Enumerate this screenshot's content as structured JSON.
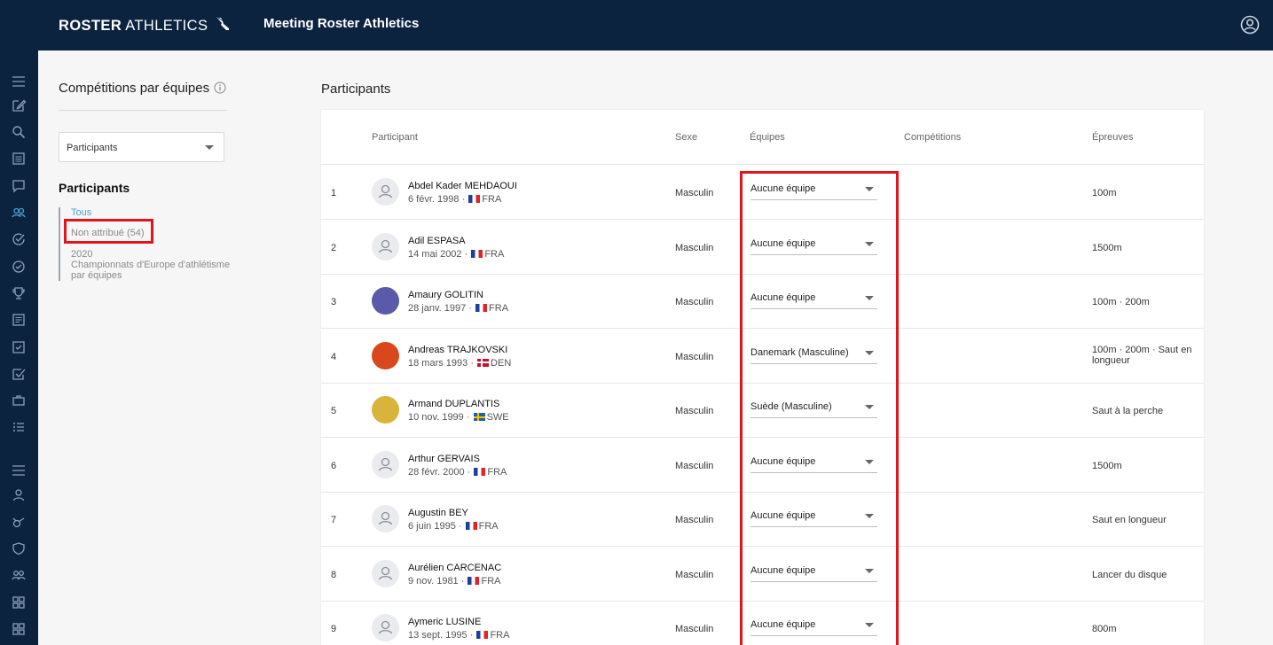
{
  "topbar": {
    "logo_bold": "ROSTER",
    "logo_light": "ATHLETICS",
    "app_title": "Meeting Roster Athletics",
    "account_icon": "account-circle-icon"
  },
  "rail_icons": [
    "menu-icon",
    "edit-icon",
    "search-icon",
    "list-icon",
    "chat-icon",
    "people-icon",
    "check-circle-icon",
    "check-circle-outline-icon",
    "trophy-icon",
    "news-icon",
    "checklist-icon",
    "double-check-icon",
    "briefcase-icon",
    "bullet-list-icon",
    "menu-icon",
    "person-icon",
    "whistle-icon",
    "shield-icon",
    "group-icon",
    "grid-icon",
    "grid-icon"
  ],
  "left": {
    "title": "Compétitions par équipes",
    "select_value": "Participants",
    "subtitle": "Participants",
    "filters": {
      "all": "Tous",
      "unassigned": "Non attribué (54)",
      "year": "2020",
      "event_line1": "Championnats d'Europe d'athlétisme",
      "event_line2": "par équipes"
    }
  },
  "main": {
    "title": "Participants",
    "columns": {
      "participant": "Participant",
      "sex": "Sexe",
      "teams": "Équipes",
      "competitions": "Compétitions",
      "events": "Épreuves"
    }
  },
  "rows": [
    {
      "num": "1",
      "name": "Abdel Kader MEHDAOUI",
      "date": "6 févr. 1998",
      "country": "FRA",
      "flag": "fra",
      "photo": false,
      "sex": "Masculin",
      "team": "Aucune équipe",
      "events": "100m"
    },
    {
      "num": "2",
      "name": "Adil ESPASA",
      "date": "14 mai 2002",
      "country": "FRA",
      "flag": "fra",
      "photo": false,
      "sex": "Masculin",
      "team": "Aucune équipe",
      "events": "1500m"
    },
    {
      "num": "3",
      "name": "Amaury GOLITIN",
      "date": "28 janv. 1997",
      "country": "FRA",
      "flag": "fra",
      "photo": true,
      "photo_color": "#5b5aa8",
      "sex": "Masculin",
      "team": "Aucune équipe",
      "events": "100m · 200m"
    },
    {
      "num": "4",
      "name": "Andreas TRAJKOVSKI",
      "date": "18 mars 1993",
      "country": "DEN",
      "flag": "den",
      "photo": true,
      "photo_color": "#d9481c",
      "sex": "Masculin",
      "team": "Danemark (Masculine)",
      "events": "100m · 200m · Saut en longueur"
    },
    {
      "num": "5",
      "name": "Armand DUPLANTIS",
      "date": "10 nov. 1999",
      "country": "SWE",
      "flag": "swe",
      "photo": true,
      "photo_color": "#d9b43a",
      "sex": "Masculin",
      "team": "Suède (Masculine)",
      "events": "Saut à la perche"
    },
    {
      "num": "6",
      "name": "Arthur GERVAIS",
      "date": "28 févr. 2000",
      "country": "FRA",
      "flag": "fra",
      "photo": false,
      "sex": "Masculin",
      "team": "Aucune équipe",
      "events": "1500m"
    },
    {
      "num": "7",
      "name": "Augustin BEY",
      "date": "6 juin 1995",
      "country": "FRA",
      "flag": "fra",
      "photo": false,
      "sex": "Masculin",
      "team": "Aucune équipe",
      "events": "Saut en longueur"
    },
    {
      "num": "8",
      "name": "Aurélien CARCENAC",
      "date": "9 nov. 1981",
      "country": "FRA",
      "flag": "fra",
      "photo": false,
      "sex": "Masculin",
      "team": "Aucune équipe",
      "events": "Lancer du disque"
    },
    {
      "num": "9",
      "name": "Aymeric LUSINE",
      "date": "13 sept. 1995",
      "country": "FRA",
      "flag": "fra",
      "photo": false,
      "sex": "Masculin",
      "team": "Aucune équipe",
      "events": "800m"
    }
  ],
  "colors": {
    "navy": "#0c2340",
    "accent": "#4aa3d8",
    "highlight": "#e0141c"
  }
}
